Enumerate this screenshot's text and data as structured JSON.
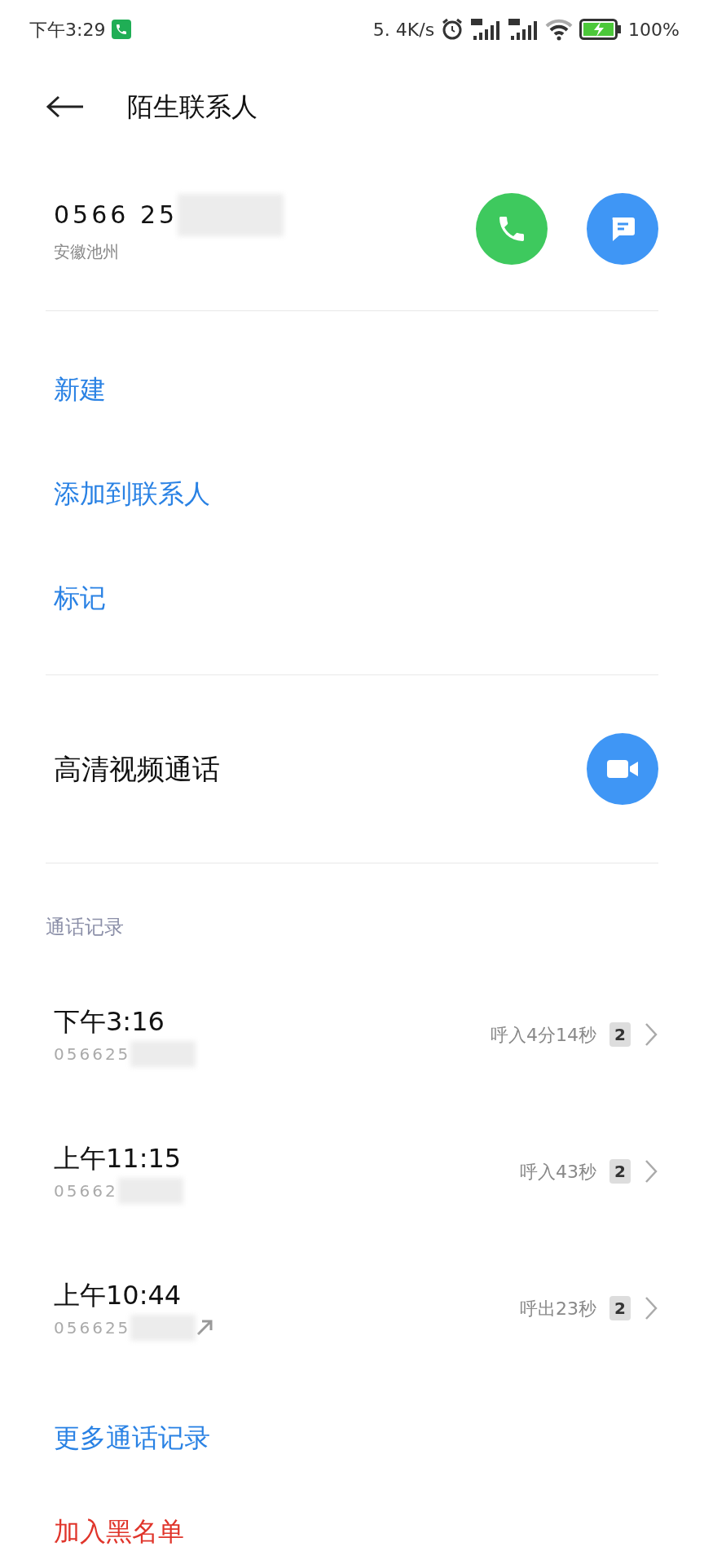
{
  "status_bar": {
    "time": "下午3:29",
    "speed": "5. 4K/s",
    "battery": "100%"
  },
  "header": {
    "title": "陌生联系人"
  },
  "contact": {
    "number": "0566 25",
    "location": "安徽池州"
  },
  "actions": [
    {
      "label": "新建"
    },
    {
      "label": "添加到联系人"
    },
    {
      "label": "标记"
    }
  ],
  "video_call": {
    "label": "高清视频通话"
  },
  "call_log": {
    "title": "通话记录",
    "entries": [
      {
        "time": "下午3:16",
        "number": "056625",
        "detail": "呼入4分14秒",
        "count": "2",
        "outgoing": false
      },
      {
        "time": "上午11:15",
        "number": "05662",
        "detail": "呼入43秒",
        "count": "2",
        "outgoing": false
      },
      {
        "time": "上午10:44",
        "number": "056625",
        "detail": "呼出23秒",
        "count": "2",
        "outgoing": true
      }
    ]
  },
  "more_link": "更多通话记录",
  "blacklist": "加入黑名单"
}
